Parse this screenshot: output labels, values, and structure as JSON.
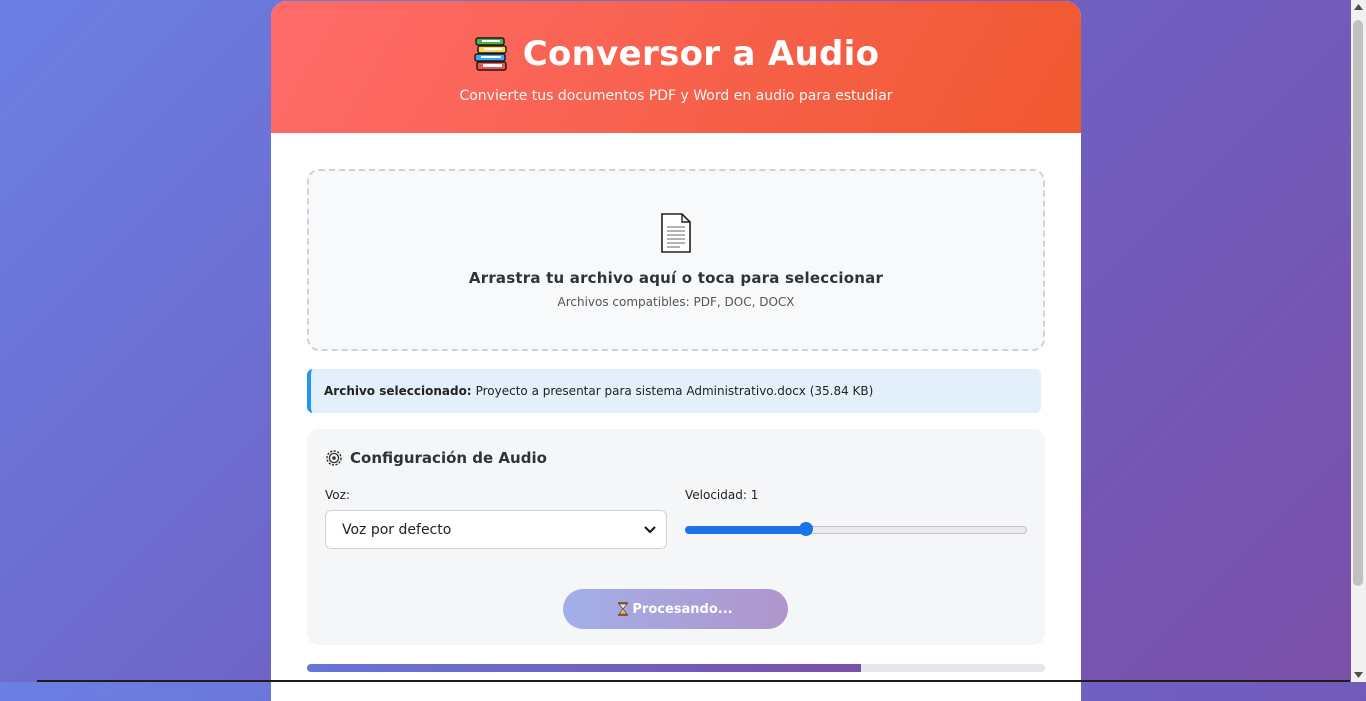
{
  "header": {
    "icon": "books-icon",
    "title": "Conversor a Audio",
    "subtitle": "Convierte tus documentos PDF y Word en audio para estudiar"
  },
  "dropzone": {
    "icon": "document-icon",
    "main_text": "Arrastra tu archivo aquí o toca para seleccionar",
    "sub_text": "Archivos compatibles: PDF, DOC, DOCX"
  },
  "file_info": {
    "label": "Archivo seleccionado:",
    "value": "Proyecto a presentar para sistema Administrativo.docx (35.84 KB)"
  },
  "config": {
    "icon": "gear-icon",
    "title": "Configuración de Audio",
    "voice_label": "Voz:",
    "voice_selected": "Voz por defecto",
    "speed_label": "Velocidad: 1",
    "speed_fraction": 0.355
  },
  "process_button": {
    "icon": "hourglass-icon",
    "label": "Procesando..."
  },
  "progress": {
    "fraction": 0.75
  },
  "colors": {
    "header_start": "#ff6b6b",
    "header_end": "#f0582f",
    "accent_blue": "#1a73e8",
    "info_border": "#2196f3"
  }
}
